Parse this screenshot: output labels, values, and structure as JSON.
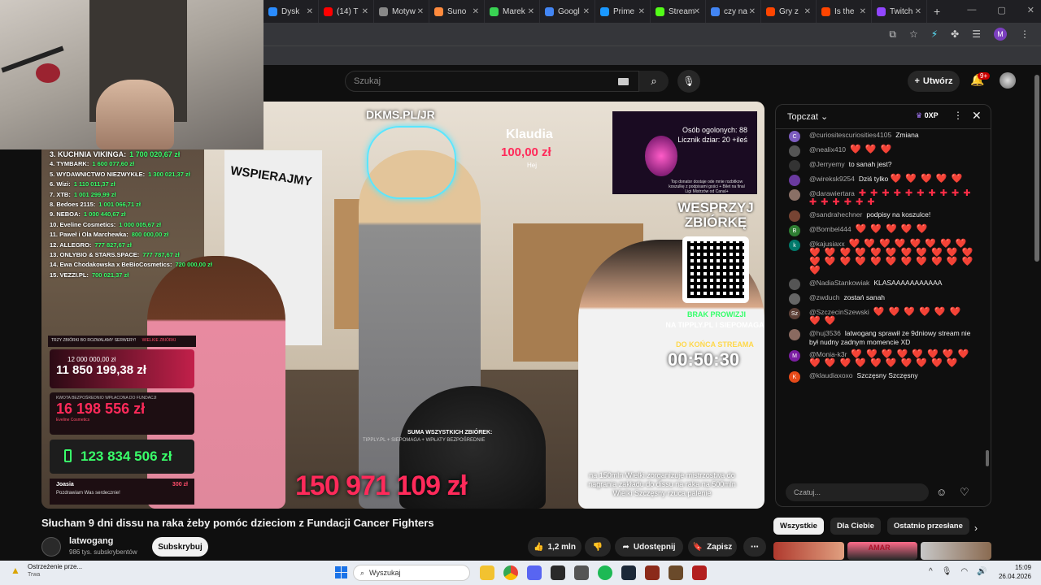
{
  "browser": {
    "tabs": [
      {
        "label": "Dysk",
        "color": "#2a8cff"
      },
      {
        "label": "(14) T",
        "color": "#ff0000"
      },
      {
        "label": "Motyw",
        "color": "#888888"
      },
      {
        "label": "Suno",
        "color": "#ff8a3d"
      },
      {
        "label": "Marek",
        "color": "#39d353"
      },
      {
        "label": "Googl",
        "color": "#4285f4"
      },
      {
        "label": "Prime",
        "color": "#1a98ff"
      },
      {
        "label": "Stream",
        "color": "#53fc18"
      },
      {
        "label": "czy na",
        "color": "#4285f4"
      },
      {
        "label": "Gry z",
        "color": "#ff4500"
      },
      {
        "label": "Is the",
        "color": "#ff4500"
      },
      {
        "label": "Twitch",
        "color": "#9146ff"
      }
    ],
    "profile_letter": "M"
  },
  "youtube": {
    "search_placeholder": "Szukaj",
    "create_label": "Utwórz",
    "notif_count": "9+"
  },
  "video": {
    "overlay": {
      "dkms": "DKMS.PL/JR",
      "donor_name": "Klaudia",
      "donor_amount": "100,00 zł",
      "donor_message": "Hej",
      "viewers_total": "Osób ogolonych: 88",
      "counter": "Licznik dziar: 20 +ileś",
      "cam_note": "Top donator dostaje ode mnie rozbitkow koszulkę z podpisami gości + Bilet na final Ligi Mistrzów od Canal+",
      "support_text": "WESPRZYJ ZBIÓRKĘ",
      "no_fee": "BRAK PROWIZJI",
      "no_fee_sites": "NA TIPPLY.PL I SIEPOMAGA",
      "until_end": "DO KOŃCA STREAMA",
      "timer": "00:50:30",
      "sum_label": "SUMA WSZYSTKICH ZBIÓREK:",
      "sum_sources": "TIPPLY.PL + SIEPOMAGA + WPŁATY BEZPOŚREDNIE",
      "total": "150 971 109 zł",
      "caption": "na 150mln Wielki zorganizuje mistrzostwa do nagrania zakładu do dissu na raka na 500mln Wielki Szczęsny rzuca palenie",
      "banner": "WSPIERAJMY",
      "panel_label": "TRZY ZBIÓRKI BO ROZWALAMY SERWERY!",
      "panel_red": "WIELKIE ZBIÓRKI",
      "goal1_label": "12 000 000,00 zł",
      "goal1_value": "11 850 199,38 zł",
      "goal2_label": "KWOTA BEZPOŚREDNIO WPŁACONA DO FUNDACJI",
      "goal2_value": "16 198 556 zł",
      "goal2_sub": "Eveline Cosmetics",
      "goal3_value": "123 834 506 zł",
      "donation_name": "Joasia",
      "donation_message": "Pozdrawiam Was serdecznie!",
      "donation_amount": "300 zł"
    },
    "leaderboard": [
      {
        "rank": "3. KUCHNIA VIKINGA:",
        "amount": "1 700 020,67 zł"
      },
      {
        "rank": "4. TYMBARK:",
        "amount": "1 600 077,60 zł"
      },
      {
        "rank": "5. WYDAWNICTWO NIEZWYKŁE:",
        "amount": "1 300 021,37 zł"
      },
      {
        "rank": "6. Wizi:",
        "amount": "1 110 011,37 zł"
      },
      {
        "rank": "7. XTB:",
        "amount": "1 001 299,99 zł"
      },
      {
        "rank": "8. Bedoes 2115:",
        "amount": "1 001 066,71 zł"
      },
      {
        "rank": "9. NEBOA:",
        "amount": "1 000 440,67 zł"
      },
      {
        "rank": "10. Eveline Cosmetics:",
        "amount": "1 000 005,67 zł"
      },
      {
        "rank": "11. Paweł i Ola Marchewka:",
        "amount": "800 000,00 zł"
      },
      {
        "rank": "12. ALLEGRO:",
        "amount": "777 827,67 zł"
      },
      {
        "rank": "13. ONLYBIO & STARS.SPACE:",
        "amount": "777 787,67 zł"
      },
      {
        "rank": "14. Ewa Chodakowska x BeBioCosmetics:",
        "amount": "720 000,00 zł"
      },
      {
        "rank": "15. VEZZI.PL:",
        "amount": "700 021,37 zł"
      }
    ]
  },
  "meta": {
    "title": "Słucham 9 dni dissu na raka żeby pomóc dzieciom z Fundacji Cancer Fighters",
    "channel": "latwogang",
    "subscribers": "986 tys. subskrybentów",
    "subscribe": "Subskrybuj",
    "likes": "1,2 mln",
    "share": "Udostępnij",
    "save": "Zapisz"
  },
  "chat": {
    "mode": "Topczat",
    "xp": "0XP",
    "input_placeholder": "Czatuj...",
    "messages": [
      {
        "user": "@curiositescuriosities4105",
        "text": "Zmiana",
        "emo": "",
        "av": "#7c5cbf",
        "letter": "C"
      },
      {
        "user": "@nealix410",
        "text": "",
        "emo": "❤️ ❤️ ❤️",
        "av": "#555555",
        "letter": ""
      },
      {
        "user": "@Jerryemy",
        "text": "to sanah jest?",
        "emo": "",
        "av": "#333333",
        "letter": ""
      },
      {
        "user": "@wireksk9254",
        "text": "Dziś tylko",
        "emo": "❤️ ❤️ ❤️ ❤️ ❤️",
        "av": "#6a3aa0",
        "letter": ""
      },
      {
        "user": "@darawiertara",
        "text": "",
        "emo": "✚ ✚ ✚ ✚ ✚ ✚ ✚ ✚ ✚ ✚ ✚ ✚ ✚ ✚ ✚ ✚",
        "av": "#8a7066",
        "letter": ""
      },
      {
        "user": "@sandrahechner",
        "text": "podpisy na koszulce!",
        "emo": "",
        "av": "#774433",
        "letter": ""
      },
      {
        "user": "@Bombel444",
        "text": "",
        "emo": "❤️ ❤️ ❤️ ❤️ ❤️",
        "av": "#2e7d32",
        "letter": "B"
      },
      {
        "user": "@kajusiaxx",
        "text": "",
        "emo": "❤️ ❤️ ❤️ ❤️ ❤️ ❤️ ❤️ ❤️ ❤️ ❤️ ❤️ ❤️ ❤️ ❤️ ❤️ ❤️ ❤️ ❤️ ❤️ ❤️ ❤️ ❤️ ❤️ ❤️ ❤️ ❤️ ❤️ ❤️ ❤️ ❤️ ❤️",
        "av": "#00796b",
        "letter": "k"
      },
      {
        "user": "@NadiaStankowiak",
        "text": "KLASAAAAAAAAAAA",
        "emo": "",
        "av": "#555555",
        "letter": ""
      },
      {
        "user": "@zwduch",
        "text": "zostań sanah",
        "emo": "",
        "av": "#666666",
        "letter": ""
      },
      {
        "user": "@SzczecinSzewski",
        "text": "",
        "emo": "❤️ ❤️ ❤️ ❤️ ❤️ ❤️ ❤️ ❤️",
        "av": "#5d4037",
        "letter": "Sz"
      },
      {
        "user": "@huj3536",
        "text": "latwogang sprawił ze 9dniowy stream nie był nudny zadnym momencie XD",
        "emo": "",
        "av": "#8a6a60",
        "letter": ""
      },
      {
        "user": "@Monia-k3r",
        "text": "",
        "emo": "❤️ ❤️ ❤️ ❤️ ❤️ ❤️ ❤️ ❤️ ❤️ ❤️ ❤️ ❤️ ❤️ ❤️ ❤️ ❤️ ❤️ ❤️",
        "av": "#7b1fa2",
        "letter": "M"
      },
      {
        "user": "@klaudiaxoxo",
        "text": "Szczęsny Szczęsny",
        "emo": "",
        "av": "#e64a19",
        "letter": "K"
      }
    ]
  },
  "related": {
    "chips": [
      "Wszystkie",
      "Dla Ciebie",
      "Ostatnio przesłane"
    ],
    "thumb_text": "AMAR"
  },
  "taskbar": {
    "warning_title": "Ostrzeżenie prze...",
    "warning_sub": "Trwa",
    "search": "Wyszukaj",
    "time": "15:09",
    "date": "26.04.2026"
  }
}
